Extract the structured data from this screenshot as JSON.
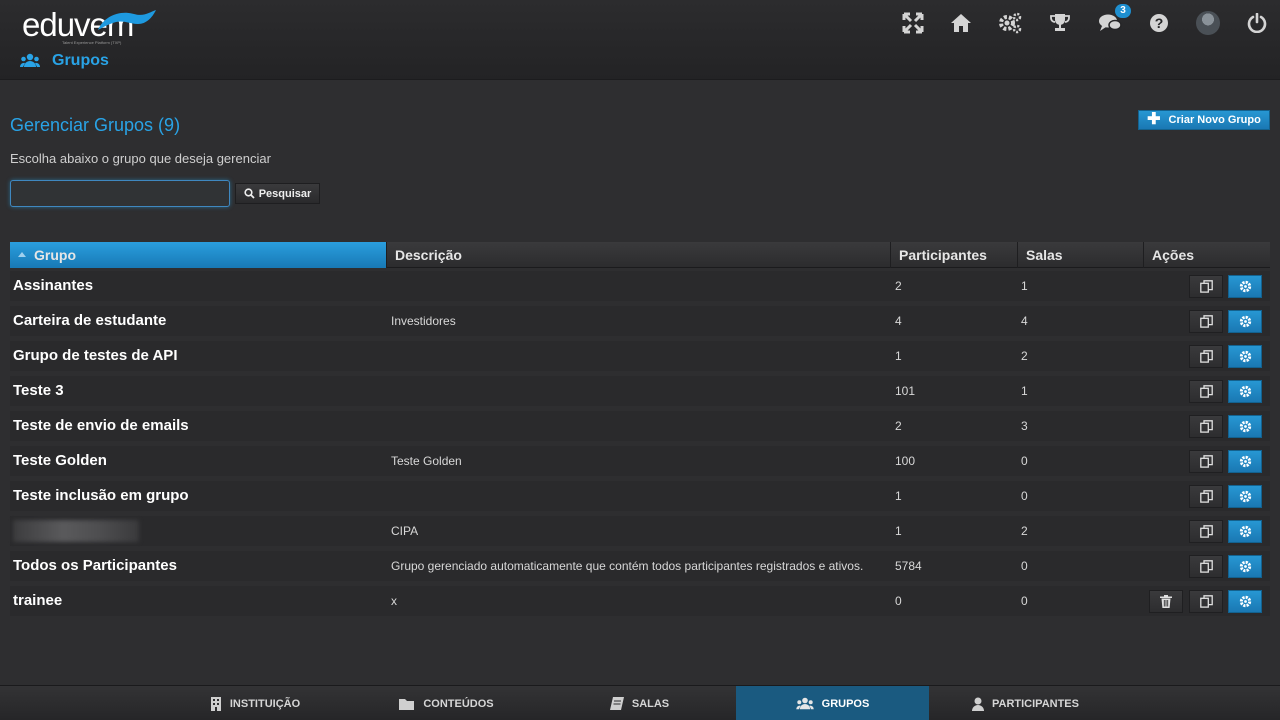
{
  "app": {
    "logo_text": "eduvem",
    "logo_tagline": "Talent Experience Platform (TXP)"
  },
  "topbar": {
    "notifications_count": "3"
  },
  "page": {
    "title": "Grupos"
  },
  "main": {
    "heading": "Gerenciar Grupos (9)",
    "subtitle": "Escolha abaixo o grupo que deseja gerenciar",
    "create_button": "Criar Novo Grupo",
    "search_value": "",
    "search_placeholder": "",
    "search_button": "Pesquisar"
  },
  "table": {
    "columns": [
      "Grupo",
      "Descrição",
      "Participantes",
      "Salas",
      "Ações"
    ],
    "rows": [
      {
        "name": "Assinantes",
        "desc": "",
        "participants": "2",
        "rooms": "1"
      },
      {
        "name": "Carteira de estudante",
        "desc": "Investidores",
        "participants": "4",
        "rooms": "4"
      },
      {
        "name": "Grupo de testes de API",
        "desc": "",
        "participants": "1",
        "rooms": "2"
      },
      {
        "name": "Teste 3",
        "desc": "",
        "participants": "101",
        "rooms": "1"
      },
      {
        "name": "Teste de envio de emails",
        "desc": "",
        "participants": "2",
        "rooms": "3"
      },
      {
        "name": "Teste Golden",
        "desc": "Teste Golden",
        "participants": "100",
        "rooms": "0"
      },
      {
        "name": "Teste inclusão em grupo",
        "desc": "",
        "participants": "1",
        "rooms": "0"
      },
      {
        "name": "",
        "desc": "CIPA",
        "participants": "1",
        "rooms": "2"
      },
      {
        "name": "Todos os Participantes",
        "desc": "Grupo gerenciado automaticamente que contém todos participantes registrados e ativos.",
        "participants": "5784",
        "rooms": "0"
      },
      {
        "name": "trainee",
        "desc": "x",
        "participants": "0",
        "rooms": "0"
      }
    ]
  },
  "bottomnav": {
    "items": [
      {
        "label": "INSTITUIÇÃO",
        "icon": "building-icon"
      },
      {
        "label": "CONTEÚDOS",
        "icon": "folder-icon"
      },
      {
        "label": "SALAS",
        "icon": "book-icon"
      },
      {
        "label": "GRUPOS",
        "icon": "users-icon"
      },
      {
        "label": "PARTICIPANTES",
        "icon": "user-icon"
      }
    ],
    "active": "GRUPOS"
  },
  "colors": {
    "accent": "#29a3e6",
    "button_blue": "#1e88c8",
    "background": "#2e2e30"
  }
}
